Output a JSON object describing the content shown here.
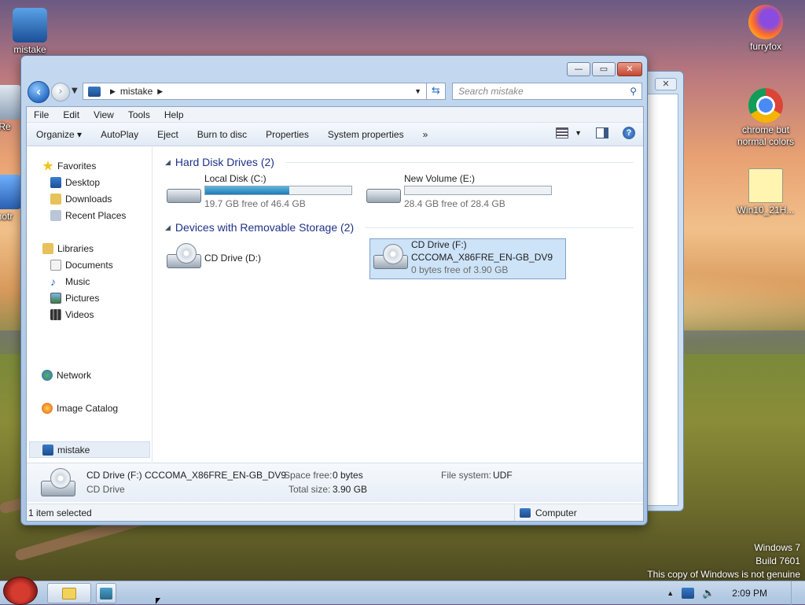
{
  "desktop": {
    "icons": [
      {
        "label": "mistake",
        "icon": "computer-icon"
      },
      {
        "label": "furryfox",
        "icon": "firefox-icon"
      },
      {
        "label": "chrome but normal colors",
        "icon": "chrome-icon"
      },
      {
        "label": "Win10_21H...",
        "icon": "iso-file-icon"
      },
      {
        "label": "Re",
        "icon": "recycle-bin-icon"
      },
      {
        "label": "notr",
        "icon": "notepad-icon"
      }
    ],
    "watermark": {
      "line1": "Windows 7",
      "line2": "Build 7601",
      "line3": "This copy of Windows is not genuine"
    }
  },
  "window": {
    "caption_buttons": {
      "minimize": "—",
      "maximize": "▭",
      "close": "✕"
    },
    "breadcrumb": {
      "location": "mistake"
    },
    "search": {
      "placeholder": "Search mistake"
    },
    "menu": [
      "File",
      "Edit",
      "View",
      "Tools",
      "Help"
    ],
    "commands": {
      "organize": "Organize ▾",
      "autoplay": "AutoPlay",
      "eject": "Eject",
      "burn": "Burn to disc",
      "properties": "Properties",
      "system_properties": "System properties",
      "more": "»"
    },
    "nav": {
      "favorites": "Favorites",
      "desktop": "Desktop",
      "downloads": "Downloads",
      "recent": "Recent Places",
      "libraries": "Libraries",
      "documents": "Documents",
      "music": "Music",
      "pictures": "Pictures",
      "videos": "Videos",
      "computer": "mistake",
      "network": "Network",
      "image_catalog": "Image Catalog"
    },
    "groups": {
      "hdd_header": "Hard Disk Drives (2)",
      "removable_header": "Devices with Removable Storage (2)"
    },
    "drives": {
      "c": {
        "name": "Local Disk (C:)",
        "free": "19.7 GB free of 46.4 GB",
        "used_fraction": 0.575
      },
      "e": {
        "name": "New Volume (E:)",
        "free": "28.4 GB free of 28.4 GB",
        "used_fraction": 0.0
      },
      "d": {
        "name": "CD Drive (D:)"
      },
      "f": {
        "name": "CD Drive (F:)",
        "label": "CCCOMA_X86FRE_EN-GB_DV9",
        "free": "0 bytes free of 3.90 GB"
      }
    },
    "details": {
      "title": "CD Drive (F:) CCCOMA_X86FRE_EN-GB_DV9",
      "type": "CD Drive",
      "space_free_label": "Space free:",
      "space_free_value": "0 bytes",
      "total_size_label": "Total size:",
      "total_size_value": "3.90 GB",
      "fs_label": "File system:",
      "fs_value": "UDF"
    },
    "status": {
      "selected": "1 item selected",
      "location": "Computer"
    }
  },
  "taskbar": {
    "clock": "2:09 PM",
    "tray_up": "▲"
  },
  "colors": {
    "accent": "#2a6fc6",
    "selection": "#cde3f8",
    "group_header": "#1e3287"
  }
}
